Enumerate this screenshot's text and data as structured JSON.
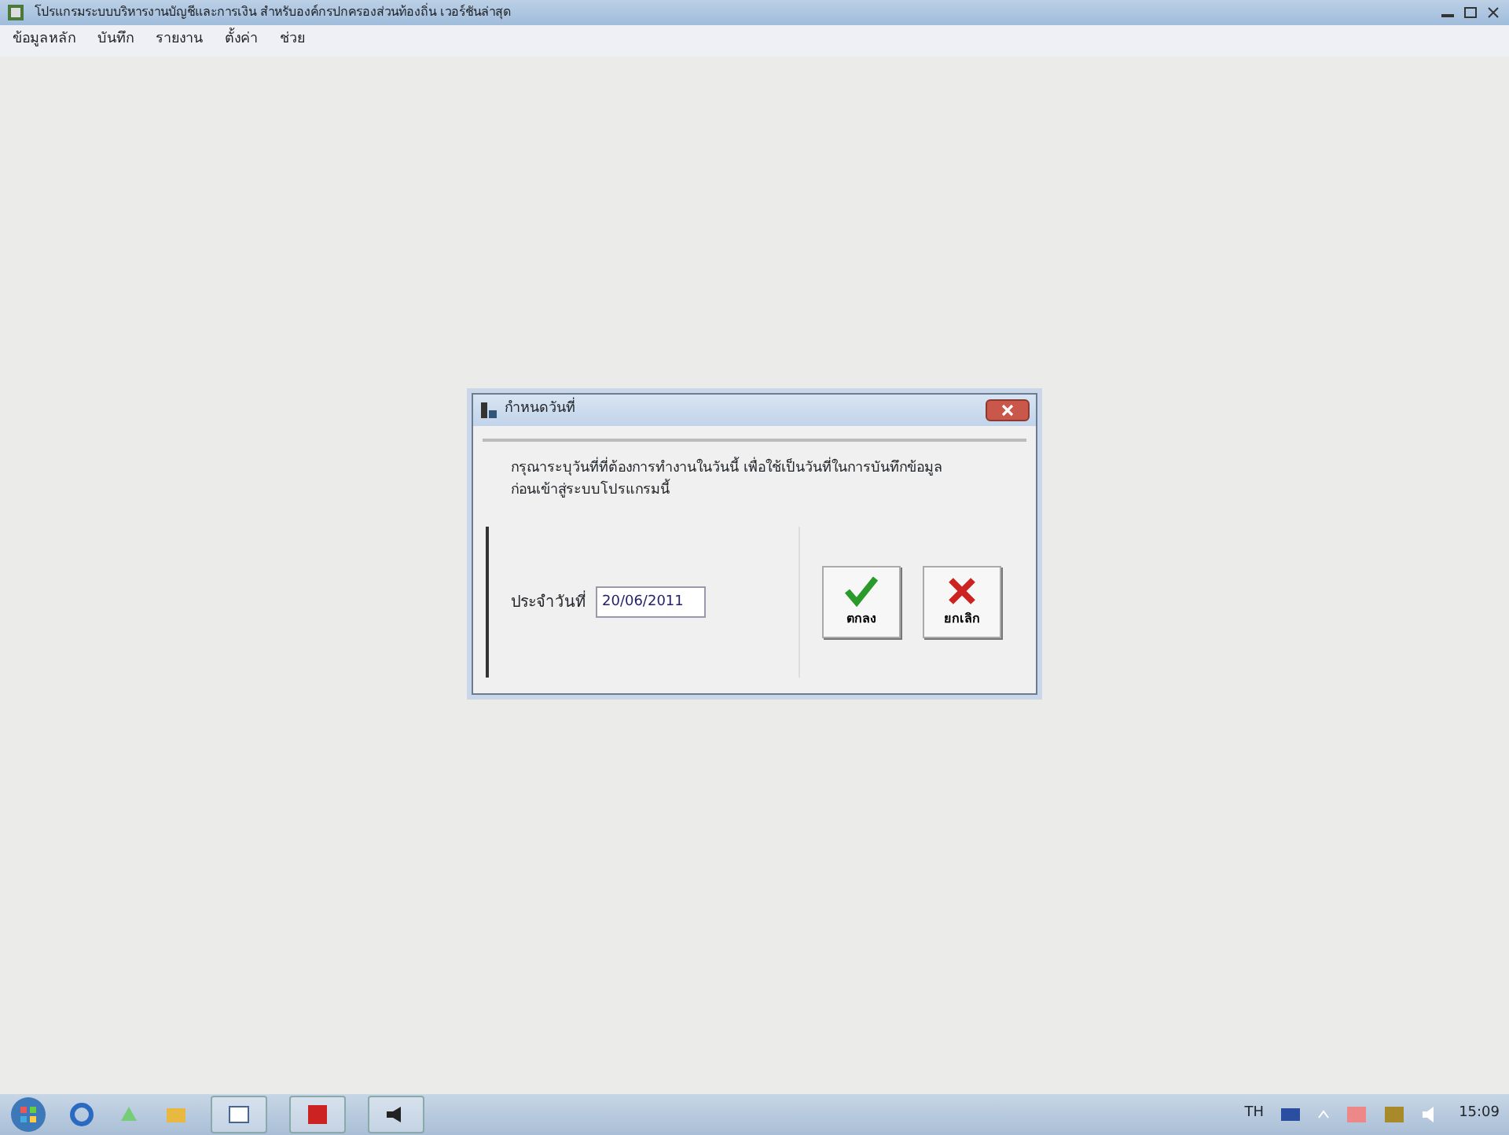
{
  "window": {
    "title": "โปรแกรมระบบบริหารงานบัญชีและการเงิน สำหรับองค์กรปกครองส่วนท้องถิ่น เวอร์ชันล่าสุด"
  },
  "menu": [
    "ข้อมูลหลัก",
    "บันทึก",
    "รายงาน",
    "ตั้งค่า",
    "ช่วย"
  ],
  "dialog": {
    "title": "กำหนดวันที่",
    "message": "กรุณาระบุวันที่ที่ต้องการทำงานในวันนี้ เพื่อใช้เป็นวันที่ในการบันทึกข้อมูล",
    "message_2": "ก่อนเข้าสู่ระบบโปรแกรมนี้",
    "date_label": "ประจำวันที่",
    "date_value": "20/06/2011",
    "buttons": [
      {
        "kind": "ok",
        "label": "ตกลง"
      },
      {
        "kind": "cancel",
        "label": "ยกเลิก"
      }
    ]
  },
  "taskbar": {
    "language": "TH",
    "clock": "15:09"
  }
}
